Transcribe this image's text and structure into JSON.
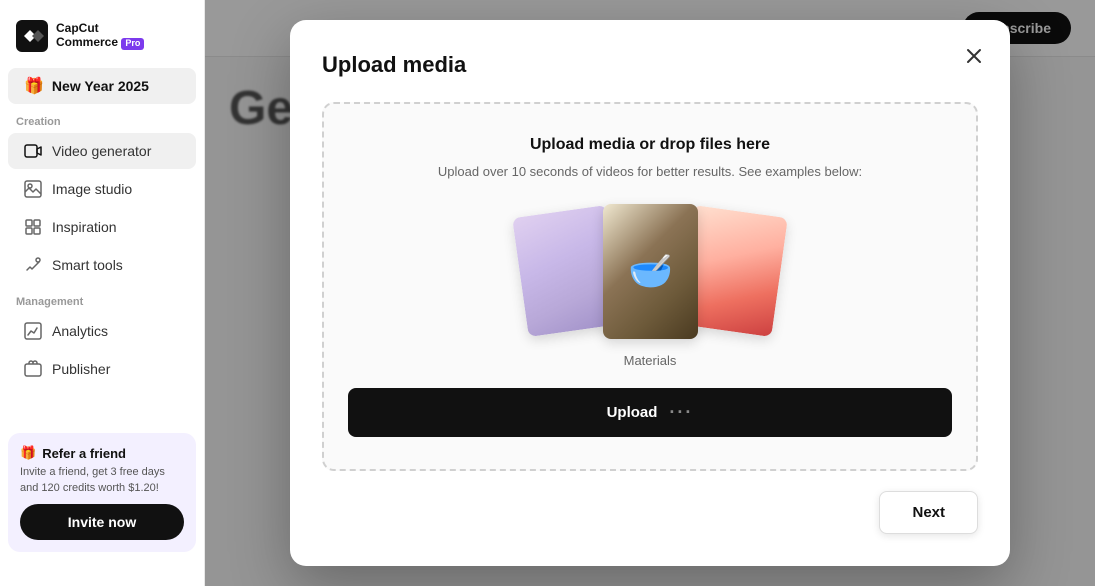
{
  "sidebar": {
    "logo": {
      "name": "CapCut",
      "sub": "Commerce",
      "badge": "Pro"
    },
    "project": {
      "emoji": "🎁",
      "name": "New Year 2025"
    },
    "sections": {
      "creation_label": "Creation",
      "management_label": "Management"
    },
    "creation_items": [
      {
        "id": "video-generator",
        "label": "Video generator",
        "icon": "video"
      },
      {
        "id": "image-studio",
        "label": "Image studio",
        "icon": "image"
      },
      {
        "id": "inspiration",
        "label": "Inspiration",
        "icon": "inspiration"
      },
      {
        "id": "smart-tools",
        "label": "Smart tools",
        "icon": "tools"
      }
    ],
    "management_items": [
      {
        "id": "analytics",
        "label": "Analytics",
        "icon": "analytics"
      },
      {
        "id": "publisher",
        "label": "Publisher",
        "icon": "publisher"
      }
    ],
    "referral": {
      "emoji": "🎁",
      "title": "Refer a friend",
      "description": "Invite a friend, get 3 free days and 120 credits worth $1.20!",
      "button_label": "Invite now"
    }
  },
  "header": {
    "subscribe_label": "Subscribe"
  },
  "main": {
    "page_title": "Ge"
  },
  "modal": {
    "title": "Upload media",
    "upload_area_title": "Upload media or drop files here",
    "upload_area_subtitle": "Upload over 10 seconds of videos for better results. See examples below:",
    "media_label": "Materials",
    "upload_button_label": "Upload",
    "upload_button_dots": "···",
    "next_button_label": "Next"
  }
}
